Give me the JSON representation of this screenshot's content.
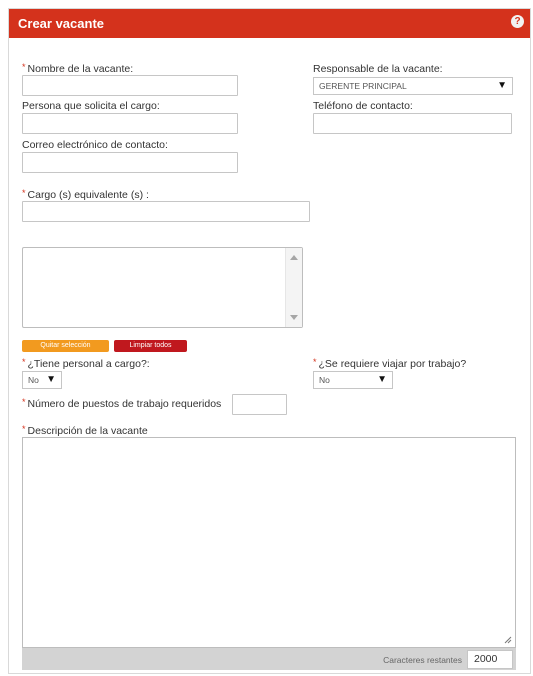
{
  "header": {
    "title": "Crear vacante",
    "help_icon": "?"
  },
  "fields": {
    "nombre_label": "Nombre de la vacante:",
    "responsable_label": "Responsable de la vacante:",
    "responsable_value": "GERENTE PRINCIPAL",
    "persona_label": "Persona que solicita el cargo:",
    "telefono_label": "Teléfono de contacto:",
    "correo_label": "Correo electrónico de contacto:",
    "cargo_label": "Cargo (s) equivalente (s) :",
    "personal_label": "¿Tiene personal a cargo?:",
    "personal_value": "No",
    "viajar_label": "¿Se requiere viajar por trabajo?",
    "viajar_value": "No",
    "puestos_label": "Número de puestos de trabajo requeridos",
    "descripcion_label": "Descripción de la vacante"
  },
  "buttons": {
    "quitar": "Quitar selección",
    "limpiar": "Limpiar todos"
  },
  "counter": {
    "label": "Caracteres restantes",
    "value": "2000"
  },
  "required_marker": "*",
  "dropdown_arrow": "▼",
  "colors": {
    "header": "#d4321c",
    "orange_button": "#f29a1f",
    "red_button": "#c0181e",
    "required": "#d4321c"
  }
}
